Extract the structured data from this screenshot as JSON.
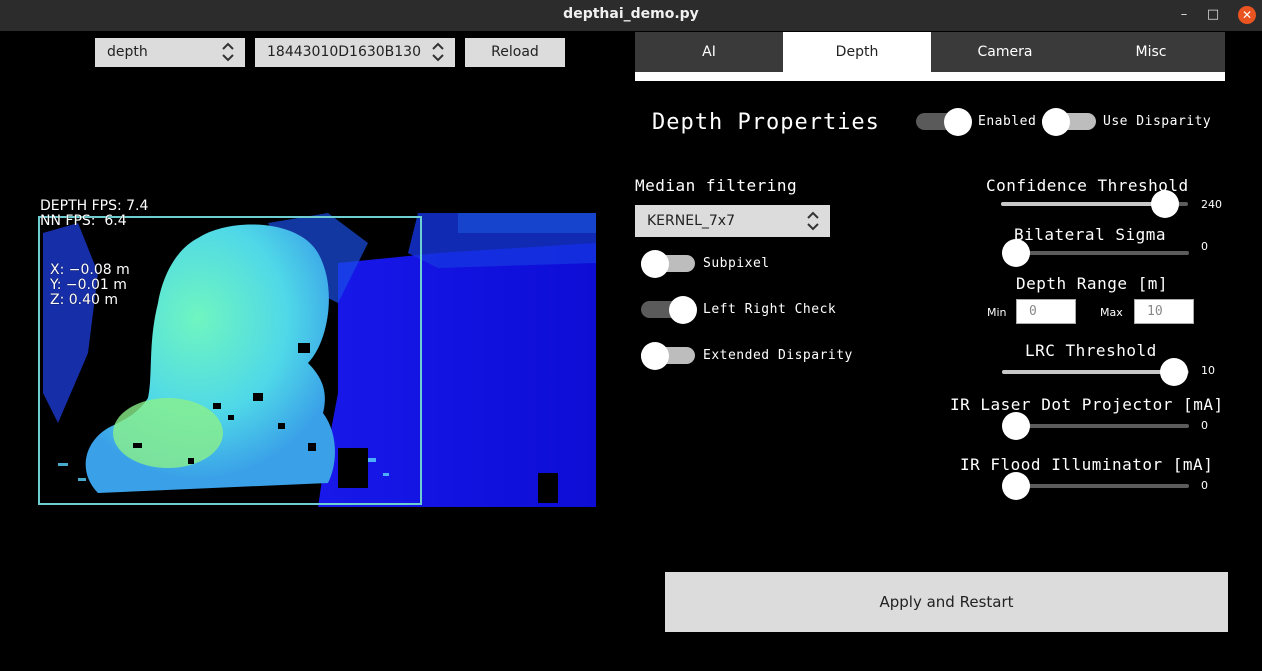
{
  "window": {
    "title": "depthai_demo.py",
    "minimize": "–",
    "maximize": "□",
    "close": "✕"
  },
  "toolbar": {
    "preview_select": "depth",
    "device_select": "18443010D1630B130",
    "reload_label": "Reload"
  },
  "preview": {
    "depth_fps": "DEPTH FPS: 7.4",
    "nn_fps": "NN FPS:  6.4",
    "x": "X: −0.08 m",
    "y": "Y: −0.01 m",
    "z": "Z: 0.40 m"
  },
  "tabs": [
    {
      "label": "AI"
    },
    {
      "label": "Depth"
    },
    {
      "label": "Camera"
    },
    {
      "label": "Misc"
    }
  ],
  "active_tab": "Depth",
  "depth": {
    "heading": "Depth Properties",
    "enabled_label": "Enabled",
    "enabled_on": true,
    "use_disparity_label": "Use Disparity",
    "use_disparity_on": false,
    "median_label": "Median filtering",
    "median_value": "KERNEL_7x7",
    "subpixel_label": "Subpixel",
    "subpixel_on": false,
    "lr_check_label": "Left Right Check",
    "lr_check_on": true,
    "extended_label": "Extended Disparity",
    "extended_on": false,
    "confidence": {
      "label": "Confidence Threshold",
      "value": "240",
      "fraction": 0.94
    },
    "bilateral": {
      "label": "Bilateral Sigma",
      "value": "0",
      "fraction": 0
    },
    "depth_range": {
      "label": "Depth Range [m]",
      "min_label": "Min",
      "min_value": "0",
      "max_label": "Max",
      "max_value": "10"
    },
    "lrc": {
      "label": "LRC Threshold",
      "value": "10",
      "fraction": 1.0
    },
    "ir_laser": {
      "label": "IR Laser Dot Projector [mA]",
      "value": "0",
      "fraction": 0
    },
    "ir_flood": {
      "label": "IR Flood Illuminator [mA]",
      "value": "0",
      "fraction": 0
    }
  },
  "apply_label": "Apply and Restart",
  "colors": {
    "titlebar": "#2c2c2c",
    "close_button": "#e95420",
    "roi_box": "#6ecfd2",
    "depth_near": "#5ef0c8",
    "depth_far": "#1010e0"
  }
}
